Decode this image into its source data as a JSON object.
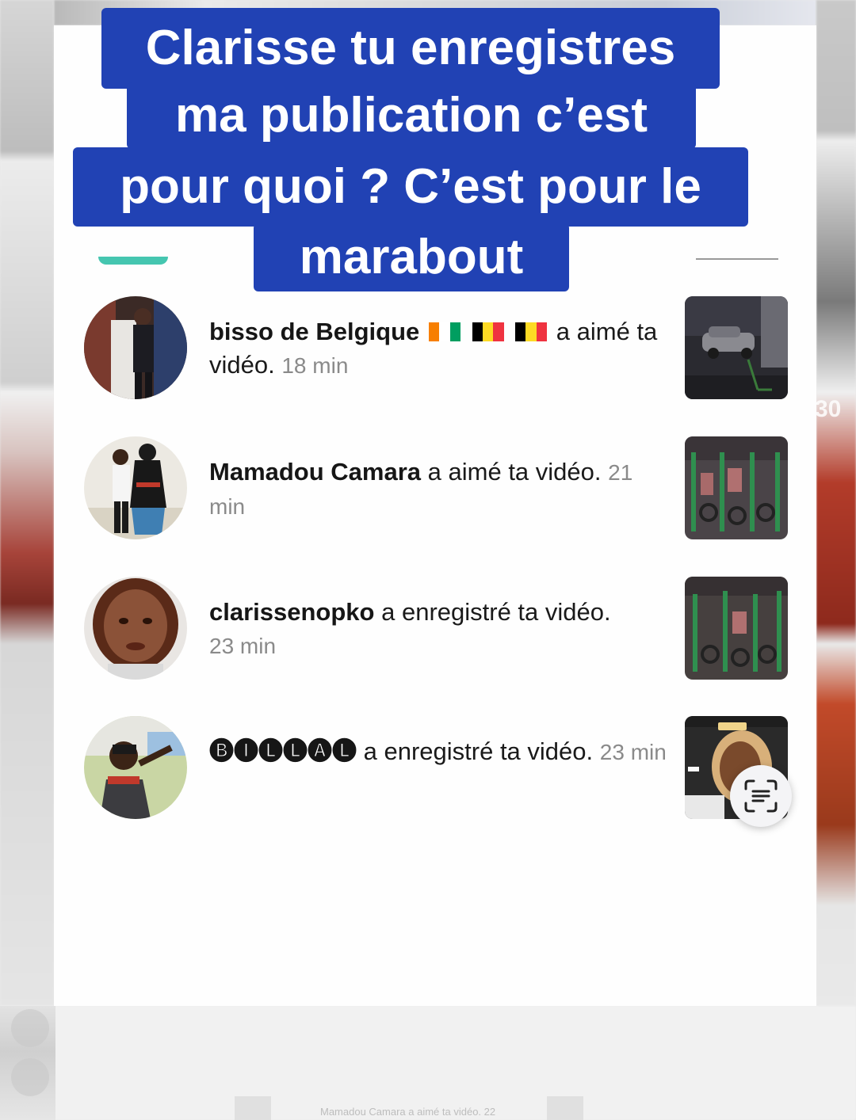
{
  "caption": {
    "line1": "Clarisse tu enregistres",
    "line2": "ma publication c’est",
    "line3": "pour quoi ? C’est pour le",
    "line4": "marabout"
  },
  "notifications": [
    {
      "user": "bisso de Belgique",
      "action": "a aimé ta vidéo.",
      "time": "18 min",
      "flags": [
        "ci",
        "be",
        "be"
      ]
    },
    {
      "user": "Mamadou Camara",
      "action": "a aimé ta vidéo.",
      "time": "21 min"
    },
    {
      "user": "clarissenopko",
      "action": "a enregistré ta vidéo.",
      "time": "23 min"
    },
    {
      "user": "🅑🅘🅛🅛🅐🅛",
      "action": "a enregistré ta vidéo.",
      "time": "23 min"
    }
  ],
  "background": {
    "side_number": "30",
    "ghost_row_text": "Mamadou Camara a aimé ta vidéo. 22"
  },
  "icons": {
    "scan": "text-scan-icon"
  },
  "colors": {
    "caption_bg": "#2142b4",
    "tab_indicator": "#45c6b0",
    "time_text": "#8a8a8a"
  }
}
